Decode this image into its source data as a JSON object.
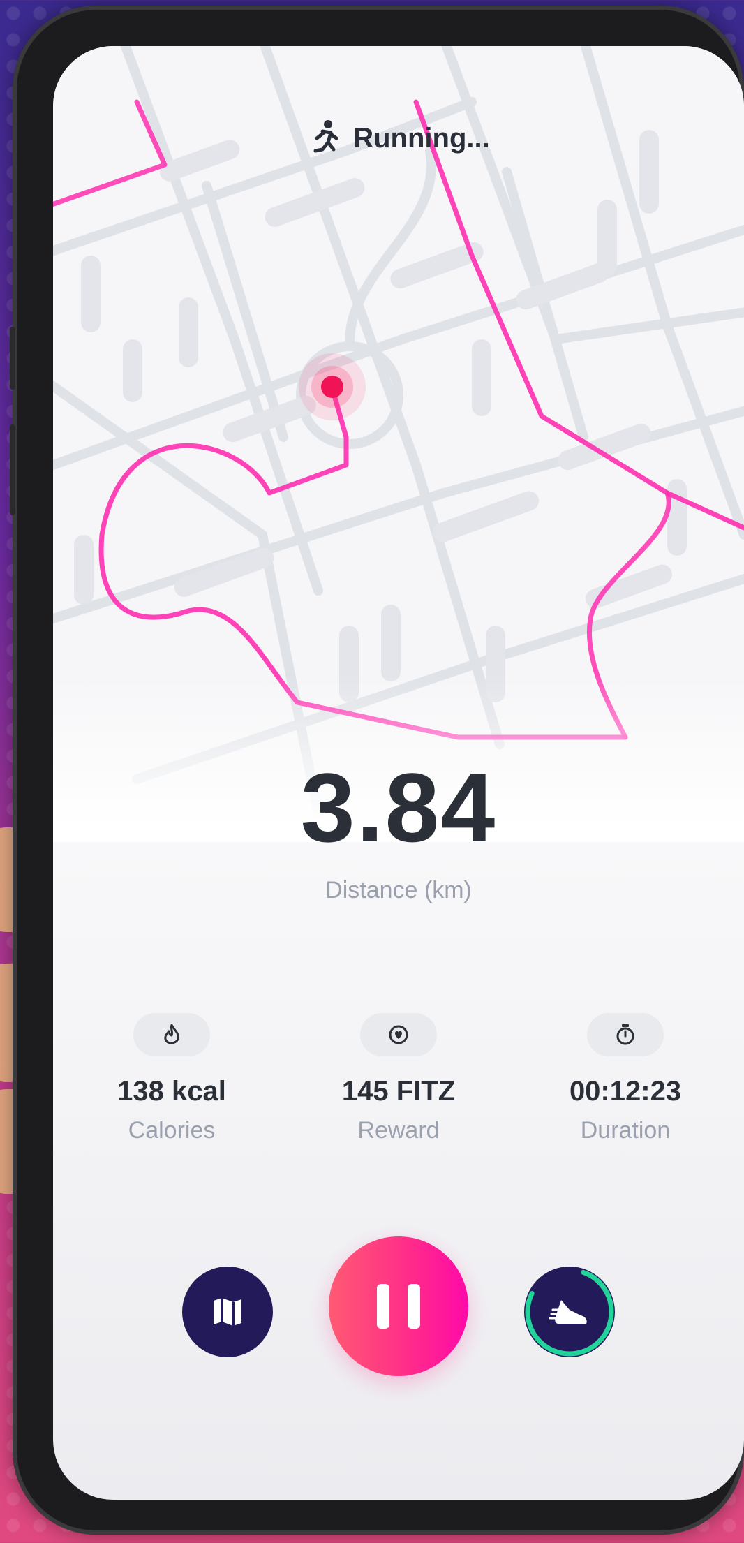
{
  "header": {
    "title": "Running...",
    "icon": "running-person-icon"
  },
  "main": {
    "distance_value": "3.84",
    "distance_label": "Distance (km)"
  },
  "stats": [
    {
      "icon": "flame-icon",
      "value": "138 kcal",
      "label": "Calories"
    },
    {
      "icon": "reward-token-icon",
      "value": "145 FITZ",
      "label": "Reward"
    },
    {
      "icon": "stopwatch-icon",
      "value": "00:12:23",
      "label": "Duration"
    }
  ],
  "controls": {
    "map_icon": "map-icon",
    "pause_icon": "pause-icon",
    "shoe_icon": "sneaker-icon"
  },
  "colors": {
    "route": "#ff2fb0",
    "accent": "#ff1e8f",
    "dark_button": "#231a5a",
    "progress_ring": "#22d39a",
    "location_dot": "#f01456"
  }
}
